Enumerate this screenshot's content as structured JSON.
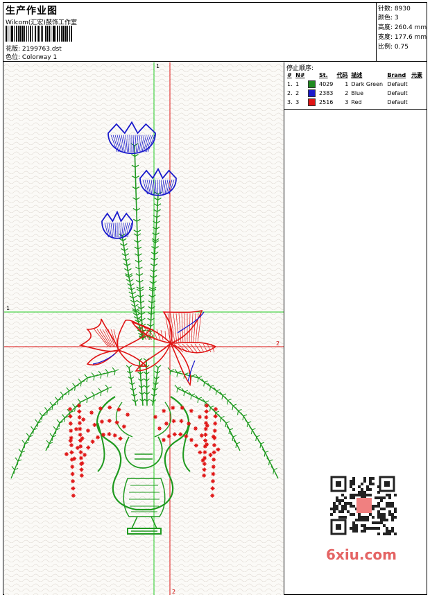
{
  "header": {
    "title": "生产作业图",
    "company": "Wilcom(汇宏)鼓饰工作室",
    "design_label": "花版:",
    "design_value": "2199763.dst",
    "color_label": "色位:",
    "color_value": "Colorway 1"
  },
  "stats": [
    {
      "label": "针数:",
      "value": "8930"
    },
    {
      "label": "颜色:",
      "value": "3"
    },
    {
      "label": "高度:",
      "value": "260.4 mm"
    },
    {
      "label": "宽度:",
      "value": "177.6 mm"
    },
    {
      "label": "比例:",
      "value": "0.75"
    }
  ],
  "stop_panel": {
    "title": "停止顺序:",
    "columns": [
      "#",
      "N#",
      "St.",
      "代码",
      "描述",
      "Brand",
      "元素"
    ],
    "rows": [
      {
        "idx": "1.",
        "n": "1",
        "color": "#1f8a1f",
        "st": "4029",
        "code": "1",
        "desc": "Dark Green",
        "brand": "Default"
      },
      {
        "idx": "2.",
        "n": "2",
        "color": "#1a1acc",
        "st": "2383",
        "code": "2",
        "desc": "Blue",
        "brand": "Default"
      },
      {
        "idx": "3.",
        "n": "3",
        "color": "#e01515",
        "st": "2516",
        "code": "3",
        "desc": "Red",
        "brand": "Default"
      }
    ]
  },
  "axes": {
    "v_green_label": "1",
    "h_green_label": "1",
    "h_red_label": "2",
    "v_red_label": "2"
  },
  "watermark": "6xiu.com",
  "colors": {
    "green": "#1f9a1f",
    "blue": "#1a1acc",
    "red": "#e01515",
    "guide_green": "#22cc22",
    "guide_red": "#dd1111"
  }
}
